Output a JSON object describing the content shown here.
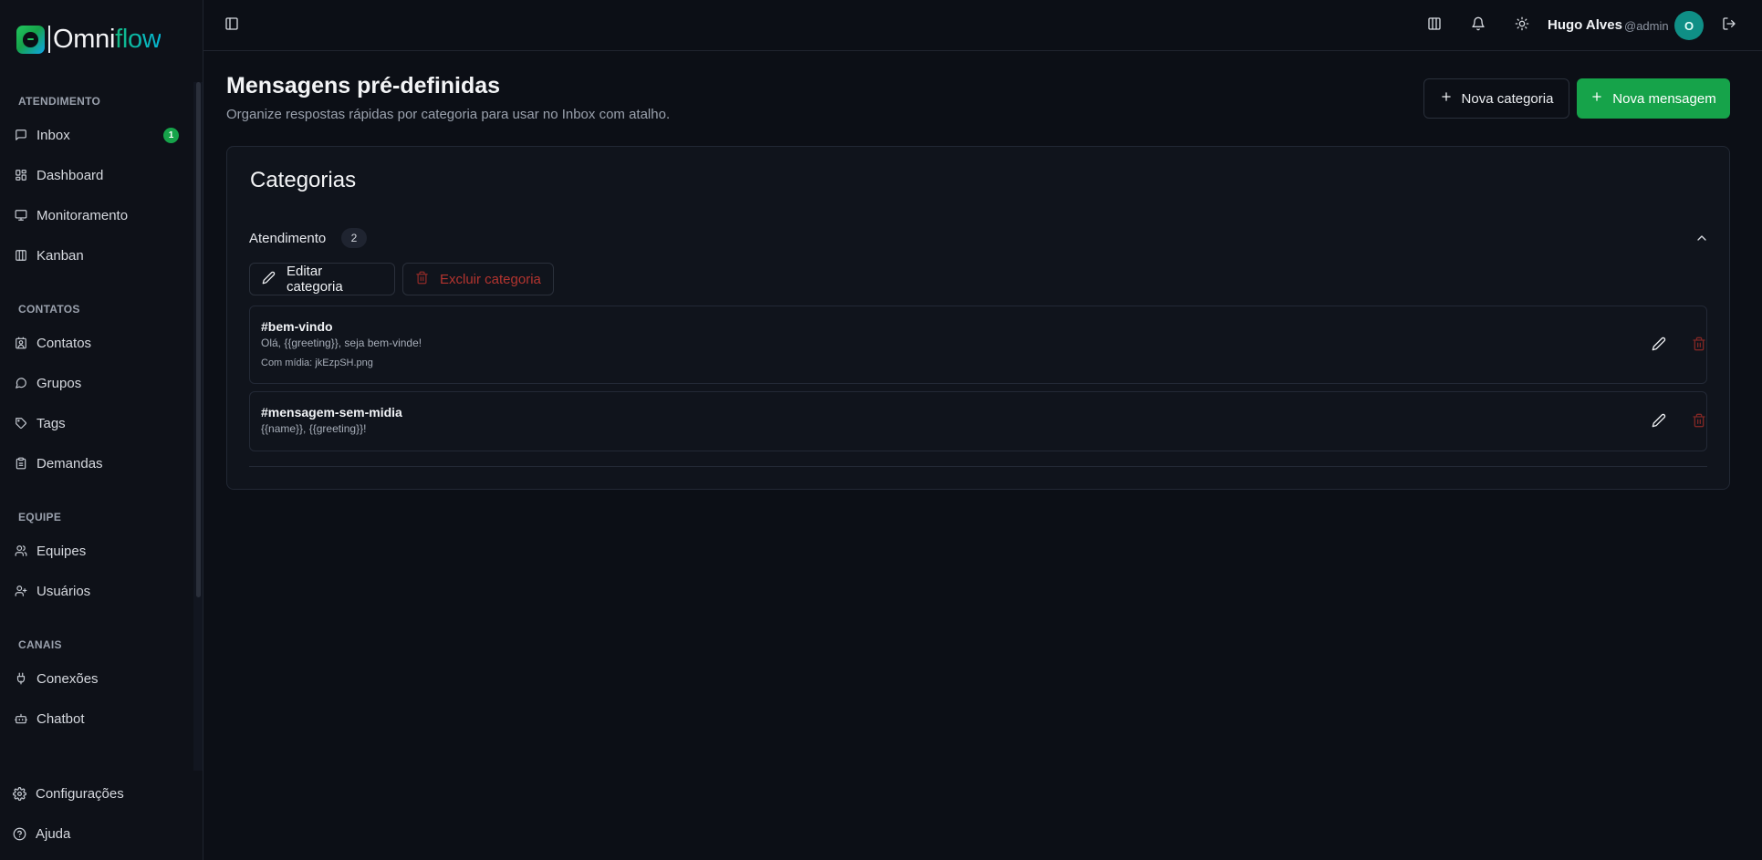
{
  "app": {
    "logo_prefix": "Omni",
    "logo_suffix": "flow"
  },
  "sidebar": {
    "sections": [
      {
        "title": "ATENDIMENTO"
      },
      {
        "title": "CONTATOS"
      },
      {
        "title": "EQUIPE"
      },
      {
        "title": "CANAIS"
      }
    ],
    "items": [
      {
        "label": "Inbox",
        "icon": "message-square-icon",
        "badge": "1"
      },
      {
        "label": "Dashboard",
        "icon": "layout-dashboard-icon"
      },
      {
        "label": "Monitoramento",
        "icon": "monitor-icon"
      },
      {
        "label": "Kanban",
        "icon": "kanban-icon"
      },
      {
        "label": "Contatos",
        "icon": "contact-icon"
      },
      {
        "label": "Grupos",
        "icon": "message-circle-icon"
      },
      {
        "label": "Tags",
        "icon": "tag-icon"
      },
      {
        "label": "Demandas",
        "icon": "clipboard-icon"
      },
      {
        "label": "Equipes",
        "icon": "users-icon"
      },
      {
        "label": "Usuários",
        "icon": "user-icon"
      },
      {
        "label": "Conexões",
        "icon": "plug-icon"
      },
      {
        "label": "Chatbot",
        "icon": "bot-icon"
      }
    ],
    "bottom": [
      {
        "label": "Configurações",
        "icon": "gear-icon"
      },
      {
        "label": "Ajuda",
        "icon": "help-circle-icon"
      }
    ]
  },
  "header": {
    "user_name": "Hugo Alves",
    "user_handle": "@admin",
    "avatar_initial": "O"
  },
  "page": {
    "title": "Mensagens pré-definidas",
    "subtitle": "Organize respostas rápidas por categoria para usar no Inbox com atalho.",
    "new_category_label": "Nova categoria",
    "new_message_label": "Nova mensagem"
  },
  "categories_card": {
    "title": "Categorias",
    "category": {
      "name": "Atendimento",
      "count": "2",
      "edit_label": "Editar categoria",
      "delete_label": "Excluir categoria"
    },
    "messages": [
      {
        "tag": "#bem-vindo",
        "text": "Olá, {{greeting}}, seja bem-vinde!",
        "media": "Com mídia: jkEzpSH.png"
      },
      {
        "tag": "#mensagem-sem-midia",
        "text": "{{name}}, {{greeting}}!"
      }
    ]
  },
  "colors": {
    "background": "#0c0f16",
    "accent_green": "#16a34a",
    "danger": "#b3342f",
    "avatar": "#0f8f86"
  }
}
